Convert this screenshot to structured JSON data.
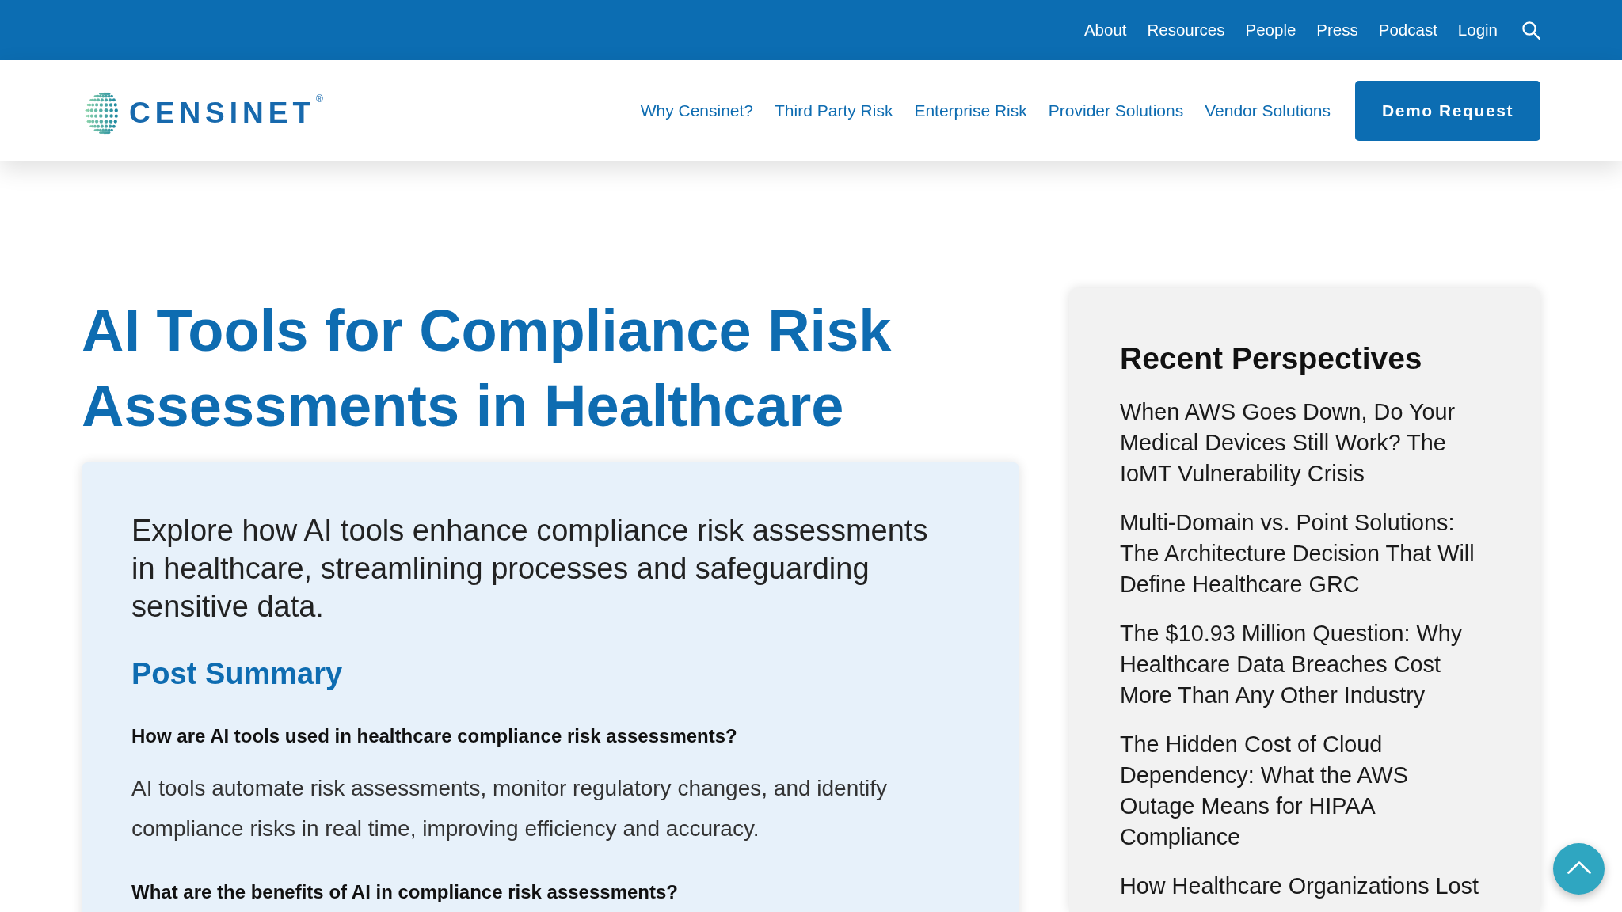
{
  "top_bar": {
    "links": [
      "About",
      "Resources",
      "People",
      "Press",
      "Podcast",
      "Login"
    ]
  },
  "header": {
    "logo": {
      "wordmark": "CENSINET",
      "mark": "®"
    },
    "nav": [
      "Why Censinet?",
      "Third Party Risk",
      "Enterprise Risk",
      "Provider Solutions",
      "Vendor Solutions"
    ],
    "cta": "Demo Request"
  },
  "article": {
    "title": "AI Tools for Compliance Risk Assessments in Healthcare",
    "intro": "Explore how AI tools enhance compliance risk assessments in healthcare, streamlining processes and safeguarding sensitive data.",
    "summary_heading": "Post Summary",
    "faq": [
      {
        "question": "How are AI tools used in healthcare compliance risk assessments?",
        "answer": "AI tools automate risk assessments, monitor regulatory changes, and identify compliance risks in real time, improving efficiency and accuracy."
      },
      {
        "question": "What are the benefits of AI in compliance risk assessments?"
      }
    ]
  },
  "sidebar": {
    "heading": "Recent Perspectives",
    "posts": [
      "When AWS Goes Down, Do Your Medical Devices Still Work? The IoMT Vulnerability Crisis",
      "Multi-Domain vs. Point Solutions: The Architecture Decision That Will Define Healthcare GRC",
      "The $10.93 Million Question: Why Healthcare Data Breaches Cost More Than Any Other Industry",
      "The Hidden Cost of Cloud Dependency: What the AWS Outage Means for HIPAA Compliance",
      "How Healthcare Organizations Lost"
    ]
  }
}
